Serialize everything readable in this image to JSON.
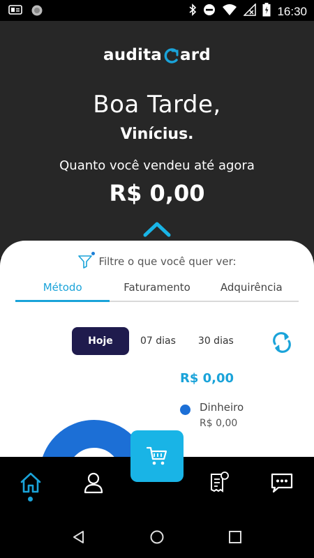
{
  "status_bar": {
    "time": "16:30",
    "icons": [
      "message-icon",
      "sync-icon",
      "bluetooth-icon",
      "do-not-disturb-icon",
      "wifi-icon",
      "no-signal-icon",
      "battery-icon"
    ]
  },
  "header": {
    "logo_part1": "audita",
    "logo_part2": "ard",
    "greeting": "Boa Tarde,",
    "username": "Vinícius.",
    "question": "Quanto você vendeu até agora",
    "total": "R$ 0,00"
  },
  "filter": {
    "label": "Filtre o que você quer ver:"
  },
  "tabs": [
    {
      "label": "Método",
      "active": true
    },
    {
      "label": "Faturamento",
      "active": false
    },
    {
      "label": "Adquirência",
      "active": false
    }
  ],
  "periods": [
    {
      "label": "Hoje",
      "active": true
    },
    {
      "label": "07 dias",
      "active": false
    },
    {
      "label": "30 dias",
      "active": false
    }
  ],
  "summary": {
    "total": "R$ 0,00",
    "legend": [
      {
        "name": "Dinheiro",
        "value": "R$ 0,00",
        "color": "#1c6fd6"
      }
    ]
  },
  "colors": {
    "accent": "#1aa3d9",
    "header_bg": "#272727",
    "active_period_bg": "#1f1b4d",
    "cart_button": "#19b4e6"
  },
  "bottom_nav": [
    "home-icon",
    "profile-icon",
    "cart-icon",
    "receipt-icon",
    "chat-icon"
  ],
  "system_nav": [
    "back-icon",
    "home-circle-icon",
    "recents-icon"
  ]
}
